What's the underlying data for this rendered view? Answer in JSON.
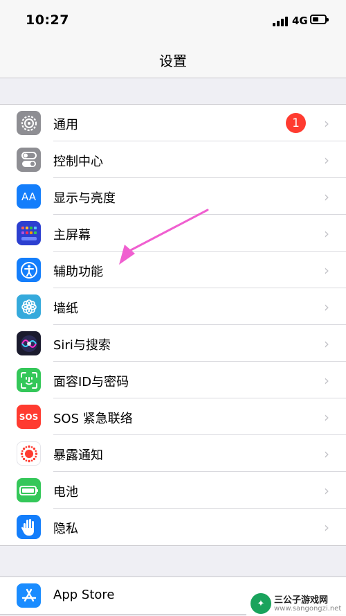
{
  "status_bar": {
    "time": "10:27",
    "network": "4G"
  },
  "nav": {
    "title": "设置"
  },
  "settings_group_1": [
    {
      "label": "通用",
      "icon": "gear-icon",
      "color": "#8e8e93",
      "badge": "1"
    },
    {
      "label": "控制中心",
      "icon": "toggles-icon",
      "color": "#8e8e93"
    },
    {
      "label": "显示与亮度",
      "icon": "text-size-icon",
      "color": "#147efb",
      "icon_text": "AA"
    },
    {
      "label": "主屏幕",
      "icon": "home-grid-icon",
      "color": "#2c3fd0"
    },
    {
      "label": "辅助功能",
      "icon": "accessibility-icon",
      "color": "#147efb"
    },
    {
      "label": "墙纸",
      "icon": "flower-icon",
      "color": "#35aadc"
    },
    {
      "label": "Siri与搜索",
      "icon": "siri-icon",
      "color": "#1b1b2e"
    },
    {
      "label": "面容ID与密码",
      "icon": "face-id-icon",
      "color": "#34c759"
    },
    {
      "label": "SOS 紧急联络",
      "icon": "sos-icon",
      "color": "#ff3b30",
      "icon_text": "SOS"
    },
    {
      "label": "暴露通知",
      "icon": "exposure-icon",
      "color": "#ffffff"
    },
    {
      "label": "电池",
      "icon": "battery-icon",
      "color": "#34c759"
    },
    {
      "label": "隐私",
      "icon": "hand-icon",
      "color": "#147efb"
    }
  ],
  "settings_group_2": [
    {
      "label": "App Store",
      "icon": "app-store-icon",
      "color": "#1a8cff"
    }
  ],
  "annotation": {
    "arrow_color": "#f05fd0"
  },
  "watermark": {
    "name": "三公子游戏网",
    "url": "www.sangongzi.net",
    "logo_icon": "android-icon"
  }
}
